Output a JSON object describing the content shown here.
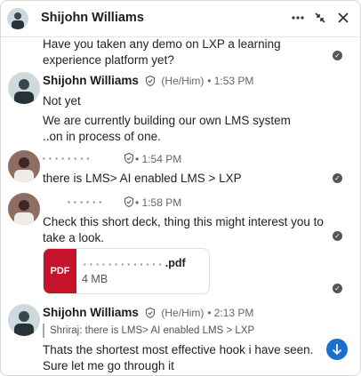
{
  "header": {
    "title": "Shijohn Williams",
    "more_icon": "more-horizontal-icon",
    "collapse_icon": "collapse-arrows-icon",
    "close_icon": "close-icon"
  },
  "messages": [
    {
      "text": "Have you taken any demo on LXP a learning experience platform yet?"
    },
    {
      "sender": "Shijohn Williams",
      "pronouns": "(He/Him)",
      "time": "1:53 PM",
      "lines": [
        "Not yet",
        "We are currently building our own LMS system ..on in process of one."
      ]
    },
    {
      "sender": "",
      "time": "1:54 PM",
      "text": "there is LMS> AI enabled LMS > LXP"
    },
    {
      "sender": "",
      "time": "1:58 PM",
      "text": "Check this short deck, thing this might interest you to take a look.",
      "attachment": {
        "badge": "PDF",
        "name": ".pdf",
        "size": "4 MB"
      }
    },
    {
      "sender": "Shijohn Williams",
      "pronouns": "(He/Him)",
      "time": "2:13 PM",
      "quote": "Shriraj: there is LMS> AI enabled LMS > LXP",
      "text": "Thats the shortest most effective hook i have seen. Sure let me go through it"
    }
  ],
  "colors": {
    "accent": "#1a6fd1",
    "pdf": "#c4132b"
  }
}
